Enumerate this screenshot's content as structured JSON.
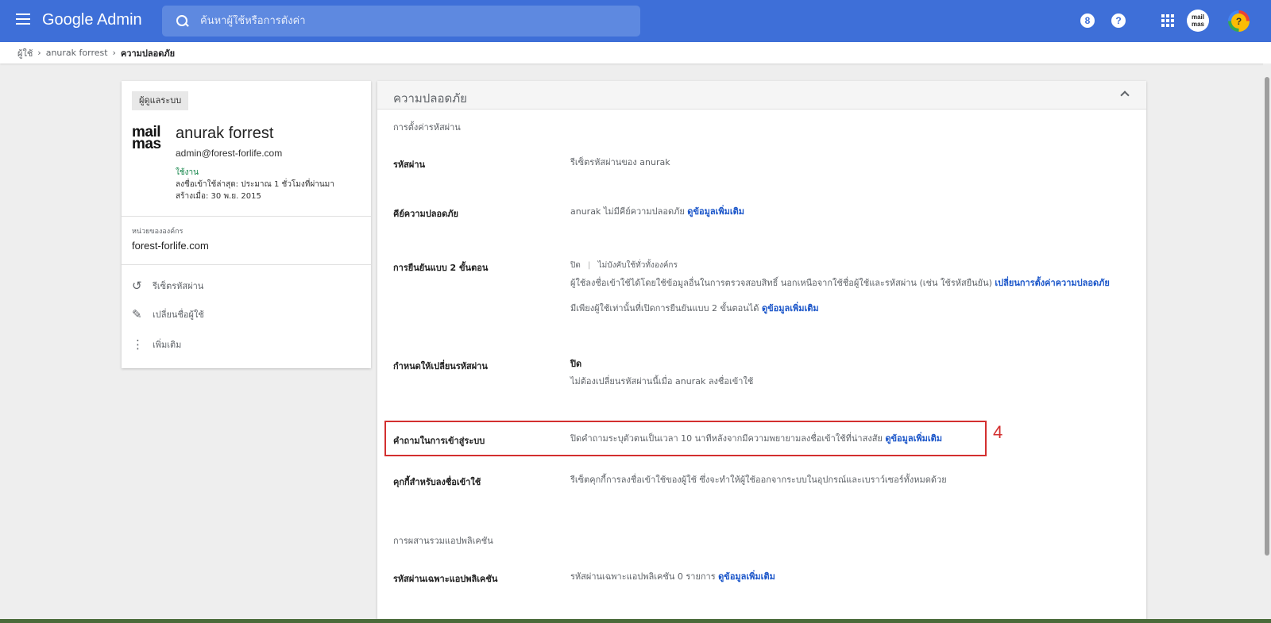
{
  "header": {
    "brand": "Google Admin",
    "search_placeholder": "ค้นหาผู้ใช้หรือการตั้งค่า",
    "notification_count": "8",
    "help_label": "?",
    "avatar_logo_line1": "mail",
    "avatar_logo_line2": "mas",
    "avatar_label": "?"
  },
  "breadcrumb": [
    "ผู้ใช้",
    "anurak forrest",
    "ความปลอดภัย"
  ],
  "user_card": {
    "badge": "ผู้ดูแลระบบ",
    "logo_line1": "mail",
    "logo_line2": "mas",
    "name": "anurak forrest",
    "email": "admin@forest-forlife.com",
    "status": "ใช้งาน",
    "last_login": "ลงชื่อเข้าใช้ล่าสุด: ประมาณ 1 ชั่วโมงที่ผ่านมา",
    "created": "สร้างเมื่อ: 30 พ.ย. 2015",
    "org_unit_label": "หน่วยขององค์กร",
    "org_unit": "forest-forlife.com",
    "actions": [
      {
        "icon": "↺",
        "label": "รีเซ็ตรหัสผ่าน"
      },
      {
        "icon": "✎",
        "label": "เปลี่ยนชื่อผู้ใช้"
      },
      {
        "icon": "⋮",
        "label": "เพิ่มเติม"
      }
    ]
  },
  "security": {
    "title": "ความปลอดภัย",
    "password_section": "การตั้งค่ารหัสผ่าน",
    "rows": {
      "password": {
        "label": "รหัสผ่าน",
        "value": "รีเซ็ตรหัสผ่านของ anurak"
      },
      "security_key": {
        "label": "คีย์ความปลอดภัย",
        "value": "anurak ไม่มีคีย์ความปลอดภัย",
        "link": "ดูข้อมูลเพิ่มเติม"
      },
      "two_step": {
        "label": "การยืนยันแบบ 2 ขั้นตอน",
        "status": "ปิด",
        "separator": "|",
        "enforcement": "ไม่บังคับใช้ทั่วทั้งองค์กร",
        "desc": "ผู้ใช้ลงชื่อเข้าใช้ได้โดยใช้ข้อมูลอื่นในการตรวจสอบสิทธิ์ นอกเหนือจากใช้ชื่อผู้ใช้และรหัสผ่าน (เช่น ใช้รหัสยืนยัน)",
        "desc_link": "เปลี่ยนการตั้งค่าความปลอดภัย",
        "note": "มีเพียงผู้ใช้เท่านั้นที่เปิดการยืนยันแบบ 2 ขั้นตอนได้",
        "note_link": "ดูข้อมูลเพิ่มเติม"
      },
      "require_change": {
        "label": "กำหนดให้เปลี่ยนรหัสผ่าน",
        "status": "ปิด",
        "desc": "ไม่ต้องเปลี่ยนรหัสผ่านนี้เมื่อ anurak ลงชื่อเข้าใช้"
      },
      "login_challenge": {
        "label": "คำถามในการเข้าสู่ระบบ",
        "value": "ปิดคำถามระบุตัวตนเป็นเวลา 10 นาทีหลังจากมีความพยายามลงชื่อเข้าใช้ที่น่าสงสัย",
        "link": "ดูข้อมูลเพิ่มเติม"
      },
      "signin_cookies": {
        "label": "คุกกี้สำหรับลงชื่อเข้าใช้",
        "value": "รีเซ็ตคุกกี้การลงชื่อเข้าใช้ของผู้ใช้ ซึ่งจะทำให้ผู้ใช้ออกจากระบบในอุปกรณ์และเบราว์เซอร์ทั้งหมดด้วย"
      }
    },
    "app_section": "การผสานรวมแอปพลิเคชัน",
    "app_passwords": {
      "label": "รหัสผ่านเฉพาะแอปพลิเคชัน",
      "value": "รหัสผ่านเฉพาะแอปพลิเคชัน 0 รายการ",
      "link": "ดูข้อมูลเพิ่มเติม"
    }
  },
  "annotation": {
    "step": "4"
  }
}
